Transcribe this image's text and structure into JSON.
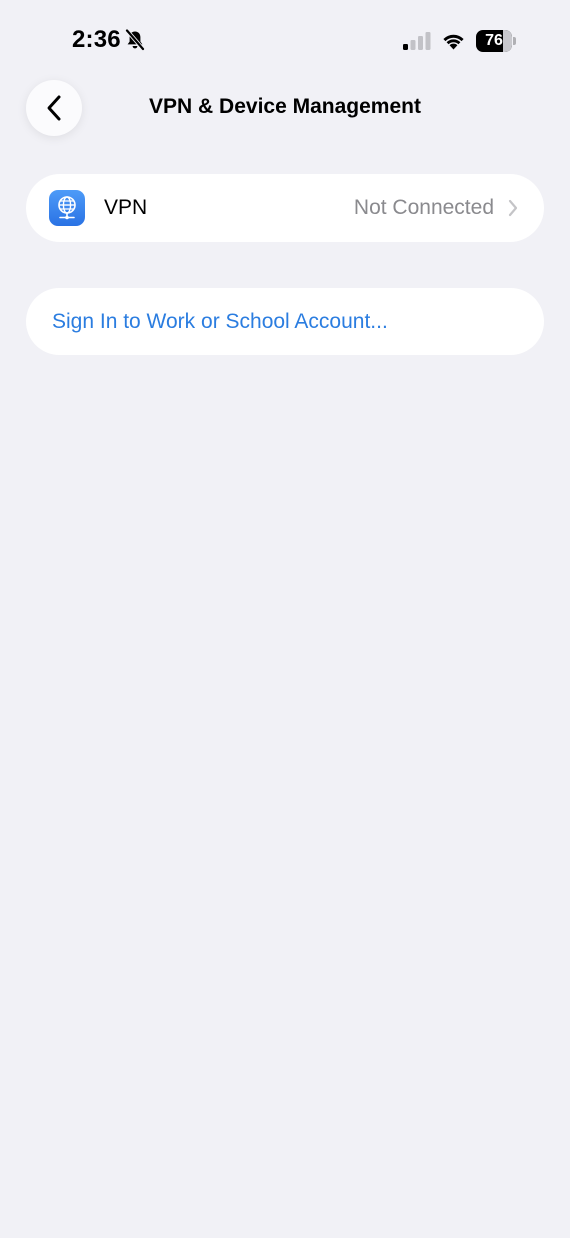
{
  "status_bar": {
    "time": "2:36",
    "silent_icon": "bell-slash-icon",
    "signal_icon": "cellular-signal-icon",
    "signal_bars_active": 1,
    "signal_bars_total": 4,
    "wifi_icon": "wifi-icon",
    "battery_level": "76",
    "battery_fraction": 0.76
  },
  "nav": {
    "back_icon": "chevron-left-icon",
    "title": "VPN & Device Management"
  },
  "vpn": {
    "icon": "globe-network-icon",
    "label": "VPN",
    "status": "Not Connected",
    "chevron_icon": "chevron-right-icon"
  },
  "account": {
    "signin_label": "Sign In to Work or School Account..."
  },
  "colors": {
    "background": "#f1f1f6",
    "link": "#2b7de0",
    "secondary_text": "#8a8a8e",
    "vpn_icon_bg": "#3a86f0"
  }
}
